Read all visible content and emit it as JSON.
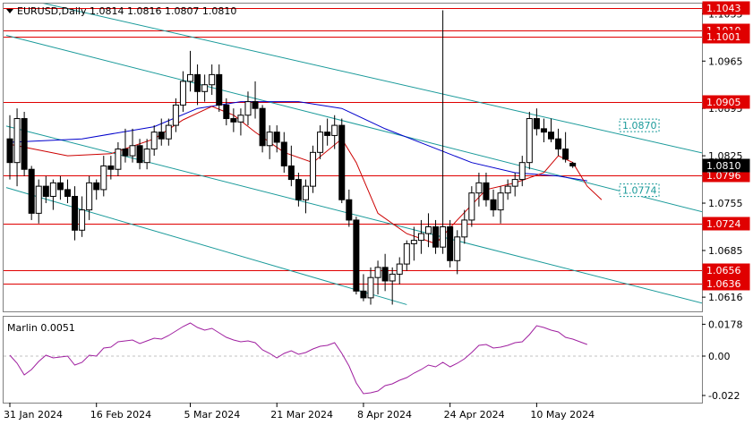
{
  "header": {
    "symbol_line": "EURUSD,Daily  1.0814 1.0816 1.0807 1.0810"
  },
  "chart_data": [
    {
      "type": "candlestick",
      "symbol": "EURUSD",
      "timeframe": "Daily",
      "ohlc_last": {
        "open": 1.0814,
        "high": 1.0816,
        "low": 1.0807,
        "close": 1.081
      },
      "ylim": [
        1.0595,
        1.105
      ],
      "y_ticks": [
        1.0616,
        1.0685,
        1.0755,
        1.0825,
        1.0895,
        1.0965,
        1.1035
      ],
      "x_ticks": [
        {
          "label": "31 Jan 2024",
          "index": 0
        },
        {
          "label": "16 Feb 2024",
          "index": 12
        },
        {
          "label": "5 Mar 2024",
          "index": 25
        },
        {
          "label": "21 Mar 2024",
          "index": 37
        },
        {
          "label": "8 Apr 2024",
          "index": 49
        },
        {
          "label": "24 Apr 2024",
          "index": 61
        },
        {
          "label": "10 May 2024",
          "index": 73
        }
      ],
      "candles": [
        [
          1.085,
          1.0885,
          1.079,
          1.0815
        ],
        [
          1.0815,
          1.0895,
          1.078,
          1.088
        ],
        [
          1.088,
          1.089,
          1.0795,
          1.0805
        ],
        [
          1.0805,
          1.081,
          1.073,
          1.074
        ],
        [
          1.074,
          1.079,
          1.0725,
          1.078
        ],
        [
          1.078,
          1.0795,
          1.0755,
          1.0765
        ],
        [
          1.0765,
          1.079,
          1.0745,
          1.0785
        ],
        [
          1.0785,
          1.0795,
          1.076,
          1.0775
        ],
        [
          1.0775,
          1.079,
          1.0755,
          1.0765
        ],
        [
          1.0765,
          1.078,
          1.07,
          1.0715
        ],
        [
          1.0715,
          1.0765,
          1.0705,
          1.0745
        ],
        [
          1.0745,
          1.0795,
          1.073,
          1.0785
        ],
        [
          1.0785,
          1.079,
          1.076,
          1.0775
        ],
        [
          1.0775,
          1.0825,
          1.0765,
          1.081
        ],
        [
          1.081,
          1.0825,
          1.079,
          1.0805
        ],
        [
          1.0805,
          1.0845,
          1.0795,
          1.0835
        ],
        [
          1.0835,
          1.0865,
          1.0815,
          1.0825
        ],
        [
          1.0825,
          1.0865,
          1.0815,
          1.084
        ],
        [
          1.084,
          1.085,
          1.0805,
          1.0815
        ],
        [
          1.0815,
          1.085,
          1.0805,
          1.0835
        ],
        [
          1.0835,
          1.087,
          1.0825,
          1.086
        ],
        [
          1.086,
          1.088,
          1.084,
          1.085
        ],
        [
          1.085,
          1.088,
          1.084,
          1.087
        ],
        [
          1.087,
          1.091,
          1.086,
          1.09
        ],
        [
          1.09,
          1.095,
          1.089,
          1.0935
        ],
        [
          1.0935,
          1.098,
          1.092,
          1.0945
        ],
        [
          1.0945,
          1.096,
          1.09,
          1.092
        ],
        [
          1.092,
          1.0945,
          1.0905,
          1.093
        ],
        [
          1.093,
          1.096,
          1.0915,
          1.0945
        ],
        [
          1.0945,
          1.096,
          1.089,
          1.09
        ],
        [
          1.09,
          1.091,
          1.087,
          1.088
        ],
        [
          1.088,
          1.0895,
          1.086,
          1.0875
        ],
        [
          1.0875,
          1.0895,
          1.0855,
          1.0885
        ],
        [
          1.0885,
          1.092,
          1.087,
          1.0905
        ],
        [
          1.0905,
          1.0935,
          1.088,
          1.0895
        ],
        [
          1.0895,
          1.09,
          1.083,
          1.084
        ],
        [
          1.084,
          1.087,
          1.082,
          1.086
        ],
        [
          1.086,
          1.087,
          1.083,
          1.0845
        ],
        [
          1.0845,
          1.086,
          1.08,
          1.081
        ],
        [
          1.081,
          1.084,
          1.078,
          1.079
        ],
        [
          1.079,
          1.08,
          1.075,
          1.076
        ],
        [
          1.076,
          1.079,
          1.074,
          1.078
        ],
        [
          1.078,
          1.084,
          1.077,
          1.083
        ],
        [
          1.083,
          1.087,
          1.082,
          1.086
        ],
        [
          1.086,
          1.088,
          1.084,
          1.0855
        ],
        [
          1.0855,
          1.0885,
          1.0835,
          1.087
        ],
        [
          1.087,
          1.088,
          1.0755,
          1.076
        ],
        [
          1.076,
          1.0775,
          1.072,
          1.073
        ],
        [
          1.073,
          1.0735,
          1.062,
          1.0625
        ],
        [
          1.0625,
          1.065,
          1.061,
          1.0615
        ],
        [
          1.0615,
          1.066,
          1.0605,
          1.0645
        ],
        [
          1.0645,
          1.067,
          1.062,
          1.066
        ],
        [
          1.066,
          1.068,
          1.0625,
          1.064
        ],
        [
          1.064,
          1.066,
          1.0605,
          1.065
        ],
        [
          1.065,
          1.0675,
          1.0635,
          1.0665
        ],
        [
          1.0665,
          1.07,
          1.0655,
          1.0695
        ],
        [
          1.0695,
          1.072,
          1.067,
          1.07
        ],
        [
          1.07,
          1.073,
          1.068,
          1.071
        ],
        [
          1.071,
          1.074,
          1.069,
          1.072
        ],
        [
          1.072,
          1.073,
          1.068,
          1.069
        ],
        [
          1.069,
          1.104,
          1.068,
          1.072
        ],
        [
          1.072,
          1.073,
          1.066,
          1.067
        ],
        [
          1.067,
          1.0715,
          1.065,
          1.0705
        ],
        [
          1.0705,
          1.0745,
          1.0695,
          1.073
        ],
        [
          1.073,
          1.078,
          1.072,
          1.077
        ],
        [
          1.077,
          1.08,
          1.075,
          1.0785
        ],
        [
          1.0785,
          1.08,
          1.075,
          1.076
        ],
        [
          1.076,
          1.0775,
          1.0735,
          1.0745
        ],
        [
          1.0745,
          1.078,
          1.0725,
          1.077
        ],
        [
          1.077,
          1.079,
          1.076,
          1.078
        ],
        [
          1.078,
          1.08,
          1.0765,
          1.079
        ],
        [
          1.079,
          1.0825,
          1.078,
          1.0815
        ],
        [
          1.0815,
          1.089,
          1.0805,
          1.088
        ],
        [
          1.088,
          1.0895,
          1.0855,
          1.0865
        ],
        [
          1.0865,
          1.088,
          1.0845,
          1.086
        ],
        [
          1.086,
          1.088,
          1.0845,
          1.085
        ],
        [
          1.085,
          1.0865,
          1.0825,
          1.0835
        ],
        [
          1.0835,
          1.086,
          1.0815,
          1.082
        ],
        [
          1.0814,
          1.0816,
          1.0807,
          1.081
        ]
      ],
      "horizontal_levels": [
        {
          "value": 1.1043,
          "label": "1.1043"
        },
        {
          "value": 1.101,
          "label": "1.1010"
        },
        {
          "value": 1.1001,
          "label": "1.1001"
        },
        {
          "value": 1.0905,
          "label": "1.0905"
        },
        {
          "value": 1.0796,
          "label": "1.0796"
        },
        {
          "value": 1.0724,
          "label": "1.0724"
        },
        {
          "value": 1.0656,
          "label": "1.0656"
        },
        {
          "value": 1.0636,
          "label": "1.0636"
        }
      ],
      "current_price": {
        "value": 1.081,
        "label": "1.0810"
      },
      "trendlines": [
        {
          "from": [
            -0.5,
            1.1063
          ],
          "to": [
            96,
            1.0829
          ],
          "label": "1.0870",
          "label_at": 84
        },
        {
          "from": [
            -0.5,
            1.1003
          ],
          "to": [
            96,
            1.0742
          ],
          "label": "",
          "label_at": null
        },
        {
          "from": [
            -0.5,
            1.0869
          ],
          "to": [
            96,
            1.0607
          ],
          "label": "",
          "label_at": null
        },
        {
          "from": [
            -0.5,
            1.0778
          ],
          "to": [
            55,
            1.0605
          ],
          "label": "",
          "label_at": null
        }
      ],
      "trendline_value_labels": [
        {
          "index": 84,
          "value": 1.087,
          "label": "1.0870"
        },
        {
          "index": 84,
          "value": 1.0774,
          "label": "1.0774"
        }
      ],
      "moving_averages": [
        {
          "color": "#0000cc",
          "points": [
            [
              0,
              1.0845
            ],
            [
              10,
              1.085
            ],
            [
              20,
              1.0868
            ],
            [
              26,
              1.0895
            ],
            [
              32,
              1.0905
            ],
            [
              40,
              1.0905
            ],
            [
              46,
              1.0895
            ],
            [
              52,
              1.0865
            ],
            [
              58,
              1.084
            ],
            [
              64,
              1.0815
            ],
            [
              70,
              1.08
            ],
            [
              76,
              1.0795
            ],
            [
              80,
              1.0788
            ]
          ]
        },
        {
          "color": "#cc0000",
          "points": [
            [
              0,
              1.0842
            ],
            [
              8,
              1.0825
            ],
            [
              14,
              1.0828
            ],
            [
              20,
              1.085
            ],
            [
              24,
              1.0878
            ],
            [
              28,
              1.0898
            ],
            [
              31,
              1.0885
            ],
            [
              34,
              1.086
            ],
            [
              38,
              1.083
            ],
            [
              42,
              1.0815
            ],
            [
              46,
              1.085
            ],
            [
              48,
              1.0815
            ],
            [
              51,
              1.074
            ],
            [
              55,
              1.071
            ],
            [
              59,
              1.0695
            ],
            [
              62,
              1.073
            ],
            [
              66,
              1.0775
            ],
            [
              70,
              1.0785
            ],
            [
              74,
              1.08
            ],
            [
              76,
              1.0825
            ],
            [
              78,
              1.0815
            ],
            [
              80,
              1.078
            ],
            [
              82,
              1.076
            ]
          ]
        }
      ]
    },
    {
      "type": "line",
      "title": "Marlin 0.0051",
      "ylim": [
        -0.026,
        0.022
      ],
      "y_ticks": [
        {
          "value": 0.0178,
          "label": "0.0178"
        },
        {
          "value": 0.0,
          "label": "0.00"
        },
        {
          "value": -0.022,
          "label": "-0.022"
        }
      ],
      "series": [
        {
          "color": "#a020a0",
          "values": [
            0.0005,
            -0.004,
            -0.0105,
            -0.0075,
            -0.003,
            0.0005,
            -0.001,
            -0.0005,
            0.0,
            -0.005,
            -0.0035,
            0.0005,
            0.0,
            0.0045,
            0.005,
            0.008,
            0.0085,
            0.009,
            0.007,
            0.0085,
            0.01,
            0.0095,
            0.0115,
            0.014,
            0.0165,
            0.0185,
            0.016,
            0.0145,
            0.0155,
            0.013,
            0.0105,
            0.009,
            0.008,
            0.0085,
            0.0075,
            0.0035,
            0.0015,
            -0.001,
            0.0015,
            0.003,
            0.001,
            0.002,
            0.004,
            0.0055,
            0.006,
            0.0075,
            0.0015,
            -0.0055,
            -0.015,
            -0.021,
            -0.0205,
            -0.0195,
            -0.0165,
            -0.0155,
            -0.0135,
            -0.012,
            -0.0095,
            -0.0075,
            -0.005,
            -0.006,
            -0.0035,
            -0.006,
            -0.004,
            -0.0015,
            0.002,
            0.006,
            0.0065,
            0.0045,
            0.005,
            0.006,
            0.0075,
            0.008,
            0.012,
            0.017,
            0.016,
            0.0145,
            0.0135,
            0.0105,
            0.0095,
            0.008,
            0.0065
          ]
        }
      ]
    }
  ]
}
